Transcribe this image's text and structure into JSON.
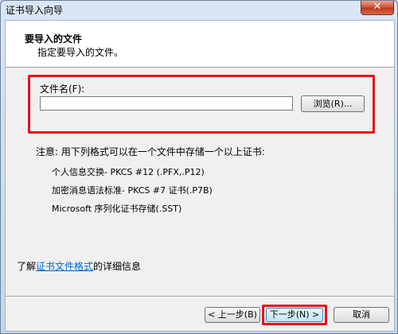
{
  "window": {
    "title": "证书导入向导",
    "close_glyph": "✕"
  },
  "header": {
    "title": "要导入的文件",
    "subtitle": "指定要导入的文件。"
  },
  "file_field": {
    "label": "文件名(F):",
    "value": "",
    "browse_label": "浏览(R)..."
  },
  "note": {
    "intro": "注意: 用下列格式可以在一个文件中存储一个以上证书:",
    "formats": [
      "个人信息交换- PKCS #12 (.PFX,.P12)",
      "加密消息语法标准- PKCS #7 证书(.P7B)",
      "Microsoft 序列化证书存储(.SST)"
    ]
  },
  "learn_more": {
    "prefix": "了解",
    "link": "证书文件格式",
    "suffix": "的详细信息"
  },
  "buttons": {
    "back": "< 上一步(B)",
    "next": "下一步(N) >",
    "cancel": "取消"
  }
}
